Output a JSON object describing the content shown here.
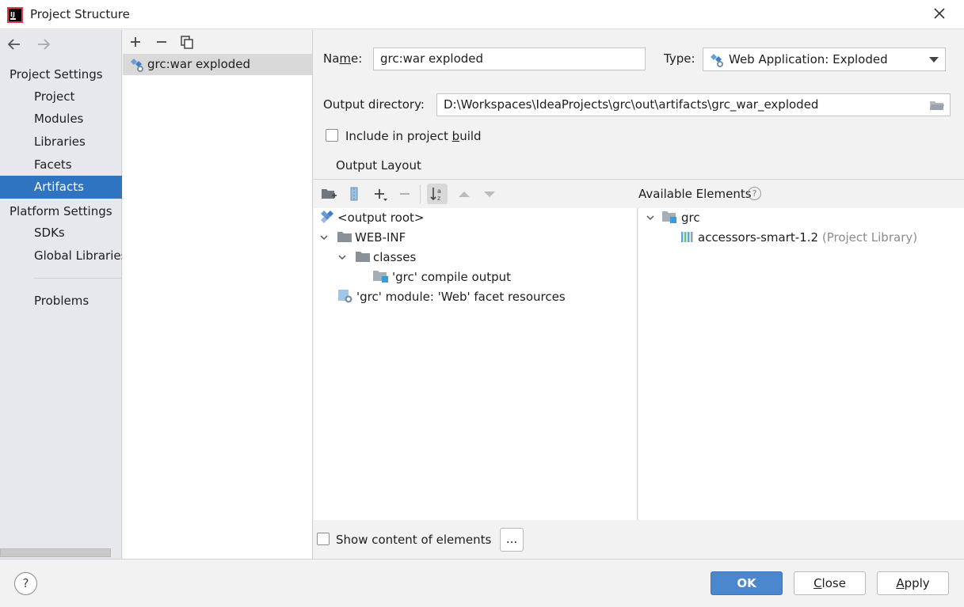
{
  "window": {
    "title": "Project Structure"
  },
  "sidebar": {
    "project_settings_header": "Project Settings",
    "project_items": [
      {
        "label": "Project"
      },
      {
        "label": "Modules"
      },
      {
        "label": "Libraries"
      },
      {
        "label": "Facets"
      },
      {
        "label": "Artifacts"
      }
    ],
    "platform_settings_header": "Platform Settings",
    "platform_items": [
      {
        "label": "SDKs"
      },
      {
        "label": "Global Libraries"
      }
    ],
    "problems_label": "Problems",
    "selected": "Artifacts"
  },
  "artifacts": {
    "items": [
      {
        "label": "grc:war exploded"
      }
    ]
  },
  "form": {
    "name_label": "Name:",
    "name_value": "grc:war exploded",
    "type_label": "Type:",
    "type_value": "Web Application: Exploded",
    "output_dir_label": "Output directory:",
    "output_dir_value": "D:\\Workspaces\\IdeaProjects\\grc\\out\\artifacts\\grc_war_exploded",
    "include_label_pre": "Include in project ",
    "include_label_underlined": "b",
    "include_label_post": "uild",
    "include_checked": false,
    "output_layout_tab": "Output Layout"
  },
  "layout_tree": [
    {
      "label": "<output root>"
    },
    {
      "label": "WEB-INF"
    },
    {
      "label": "classes"
    },
    {
      "label": "'grc' compile output"
    },
    {
      "label": "'grc' module: 'Web' facet resources"
    }
  ],
  "available": {
    "header": "Available Elements",
    "tree": [
      {
        "label": "grc"
      },
      {
        "label": "accessors-smart-1.2",
        "suffix": "(Project Library)"
      }
    ]
  },
  "show_content_label": "Show content of elements",
  "show_content_checked": false,
  "ellipsis_button": "...",
  "buttons": {
    "ok": "OK",
    "close": "Close",
    "apply": "Apply",
    "help": "?"
  },
  "colors": {
    "selection": "#2f74c0",
    "primary_button": "#4a87cf",
    "sidebar_bg": "#e6e8ed"
  }
}
